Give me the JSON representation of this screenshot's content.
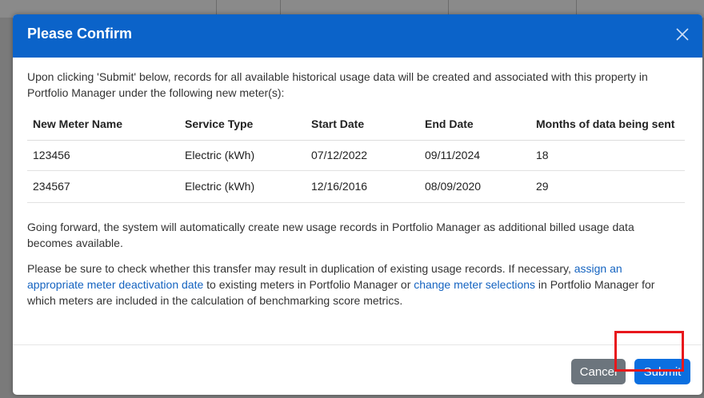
{
  "dialog": {
    "title": "Please Confirm",
    "close_icon": "close-icon",
    "intro": "Upon clicking 'Submit' below, records for all available historical usage data will be created and associated with this property in Portfolio Manager under the following new meter(s):",
    "table": {
      "headers": [
        "New Meter Name",
        "Service Type",
        "Start Date",
        "End Date",
        "Months of data being sent"
      ],
      "rows": [
        [
          "123456",
          "Electric (kWh)",
          "07/12/2022",
          "09/11/2024",
          "18"
        ],
        [
          "234567",
          "Electric (kWh)",
          "12/16/2016",
          "08/09/2020",
          "29"
        ]
      ]
    },
    "paragraph2": "Going forward, the system will automatically create new usage records in Portfolio Manager as additional billed usage data becomes available.",
    "paragraph3": {
      "text_before_link1": "Please be sure to check whether this transfer may result in duplication of existing usage records. If necessary, ",
      "link1": "assign an appropriate meter deactivation date",
      "text_between_links": " to existing meters in Portfolio Manager or ",
      "link2": "change meter selections",
      "text_after_link2": " in Portfolio Manager for which meters are included in the calculation of benchmarking score metrics."
    },
    "buttons": {
      "cancel": "Cancel",
      "submit": "Submit"
    }
  },
  "colors": {
    "header_bg": "#0b63c9",
    "submit_bg": "#0b6fe0",
    "cancel_bg": "#6c757d",
    "link": "#1463c0",
    "highlight": "#e8171c"
  }
}
